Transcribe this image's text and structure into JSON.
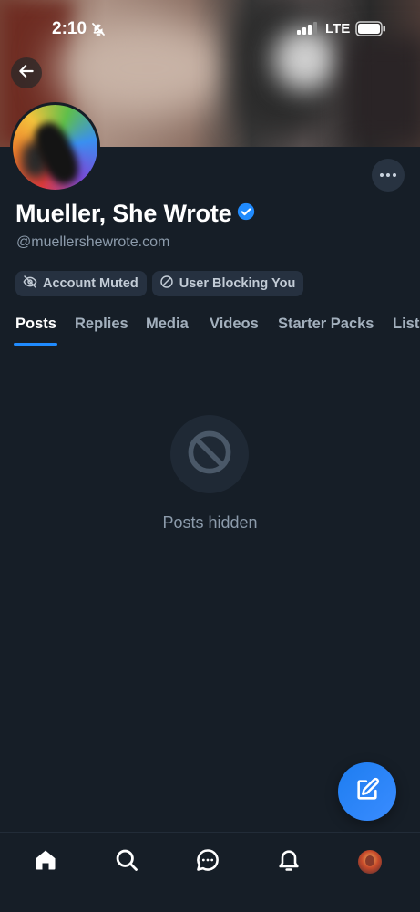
{
  "status_bar": {
    "time": "2:10",
    "network": "LTE",
    "icons": [
      "bell-off-icon",
      "signal-icon",
      "battery-icon"
    ]
  },
  "header": {
    "back_icon": "arrow-left-icon",
    "more_icon": "ellipsis-icon"
  },
  "profile": {
    "display_name": "Mueller, She Wrote",
    "verified": true,
    "handle": "@muellershewrote.com",
    "chips": [
      {
        "icon": "eye-off-icon",
        "label": "Account Muted"
      },
      {
        "icon": "block-icon",
        "label": "User Blocking You"
      }
    ]
  },
  "tabs": [
    {
      "label": "Posts",
      "active": true
    },
    {
      "label": "Replies",
      "active": false
    },
    {
      "label": "Media",
      "active": false
    },
    {
      "label": "Videos",
      "active": false
    },
    {
      "label": "Starter Packs",
      "active": false
    },
    {
      "label": "Lists",
      "active": false
    }
  ],
  "empty_state": {
    "icon": "prohibited-icon",
    "text": "Posts hidden"
  },
  "fab": {
    "icon": "compose-icon"
  },
  "bottom_nav": [
    {
      "name": "home",
      "icon": "home-icon"
    },
    {
      "name": "search",
      "icon": "search-icon"
    },
    {
      "name": "chat",
      "icon": "chat-icon"
    },
    {
      "name": "notifications",
      "icon": "bell-icon"
    },
    {
      "name": "profile",
      "icon": "avatar-icon"
    }
  ],
  "colors": {
    "background": "#161e27",
    "accent": "#208bfe",
    "muted_text": "#8c9bab",
    "chip_bg": "#263140"
  }
}
